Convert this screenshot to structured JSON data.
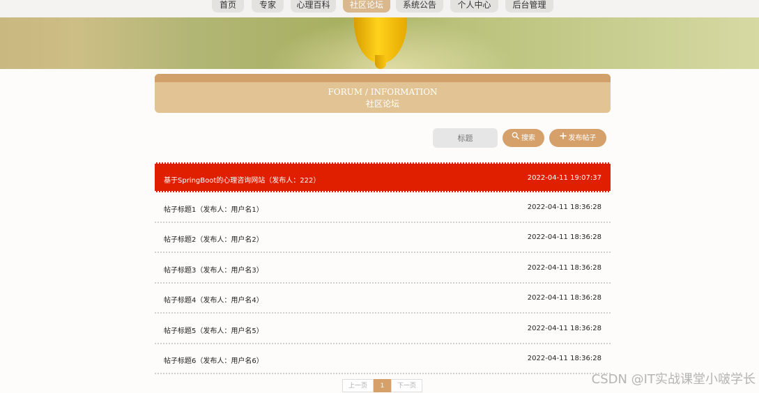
{
  "nav": {
    "items": [
      {
        "label": "首页",
        "active": false
      },
      {
        "label": "专家",
        "active": false
      },
      {
        "label": "心理百科",
        "active": false
      },
      {
        "label": "社区论坛",
        "active": true
      },
      {
        "label": "系统公告",
        "active": false
      },
      {
        "label": "个人中心",
        "active": false
      },
      {
        "label": "后台管理",
        "active": false
      }
    ]
  },
  "section": {
    "title_en": "FORUM / INFORMATION",
    "title_cn": "社区论坛"
  },
  "toolbar": {
    "search_placeholder": "标题",
    "search_button": "搜索",
    "post_button": "发布帖子"
  },
  "posts": [
    {
      "title": "基于SpringBoot的心理咨询网站（发布人：222）",
      "time": "2022-04-11 19:07:37",
      "highlighted": true
    },
    {
      "title": "帖子标题1（发布人：用户名1）",
      "time": "2022-04-11 18:36:28",
      "highlighted": false
    },
    {
      "title": "帖子标题2（发布人：用户名2）",
      "time": "2022-04-11 18:36:28",
      "highlighted": false
    },
    {
      "title": "帖子标题3（发布人：用户名3）",
      "time": "2022-04-11 18:36:28",
      "highlighted": false
    },
    {
      "title": "帖子标题4（发布人：用户名4）",
      "time": "2022-04-11 18:36:28",
      "highlighted": false
    },
    {
      "title": "帖子标题5（发布人：用户名5）",
      "time": "2022-04-11 18:36:28",
      "highlighted": false
    },
    {
      "title": "帖子标题6（发布人：用户名6）",
      "time": "2022-04-11 18:36:28",
      "highlighted": false
    }
  ],
  "pagination": {
    "prev": "上一页",
    "current": "1",
    "next": "下一页"
  },
  "watermark": "CSDN @IT实战课堂小啵学长",
  "colors": {
    "accent": "#d5a06a",
    "header_bg": "#e2c394",
    "highlight_row": "#e01e00"
  }
}
